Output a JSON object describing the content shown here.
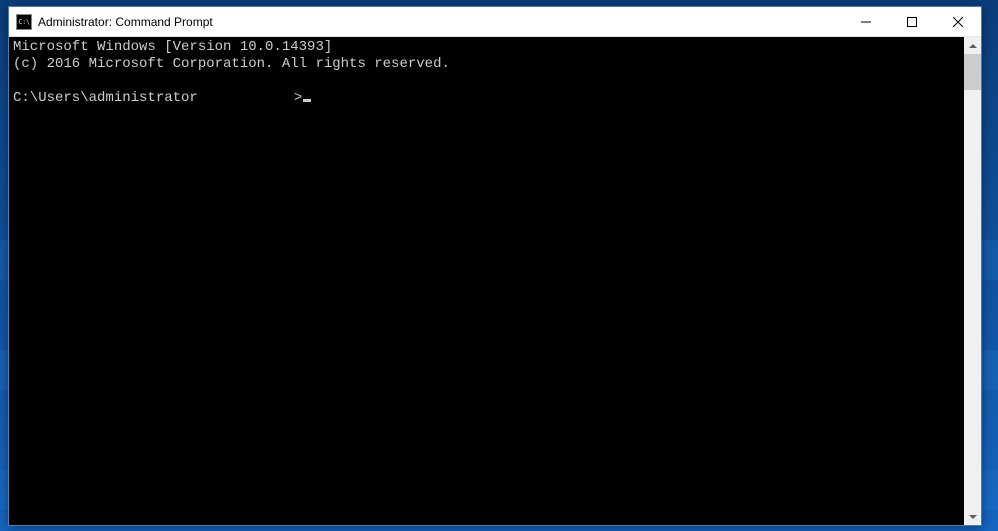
{
  "window": {
    "title": "Administrator: Command Prompt",
    "icon_text": "C:\\"
  },
  "terminal": {
    "line1": "Microsoft Windows [Version 10.0.14393]",
    "line2": "(c) 2016 Microsoft Corporation. All rights reserved.",
    "blank": "",
    "prompt_path": "C:\\Users\\administrator",
    "prompt_char": ">"
  }
}
